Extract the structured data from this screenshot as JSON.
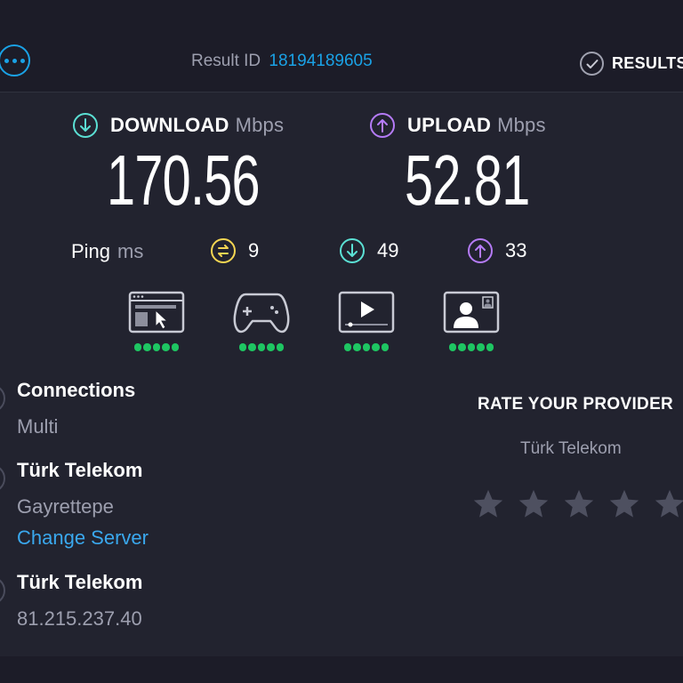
{
  "header": {
    "result_id_label": "Result ID",
    "result_id_value": "18194189605",
    "results_label": "RESULTS"
  },
  "download": {
    "label": "DOWNLOAD",
    "unit": "Mbps",
    "value": "170.56",
    "color": "#5be0d4"
  },
  "upload": {
    "label": "UPLOAD",
    "unit": "Mbps",
    "value": "52.81",
    "color": "#b57bf7"
  },
  "ping": {
    "label": "Ping",
    "unit": "ms",
    "idle": "9",
    "download": "49",
    "upload": "33",
    "idle_color": "#f5d652"
  },
  "quality": {
    "icons": [
      "web-browsing-icon",
      "gaming-icon",
      "video-streaming-icon",
      "video-chat-icon"
    ],
    "ratings": [
      5,
      5,
      5,
      5
    ],
    "dot_color": "#1ec662"
  },
  "connections": {
    "title": "Connections",
    "value": "Multi"
  },
  "server": {
    "title": "Türk Telekom",
    "location": "Gayrettepe",
    "change_label": "Change Server"
  },
  "isp": {
    "title": "Türk Telekom",
    "ip": "81.215.237.40"
  },
  "rating": {
    "title": "RATE YOUR PROVIDER",
    "provider": "Türk Telekom",
    "stars": 5,
    "selected": 0
  },
  "colors": {
    "accent": "#1aa2e6",
    "background": "#22232f",
    "muted_text": "#9d9faf"
  }
}
